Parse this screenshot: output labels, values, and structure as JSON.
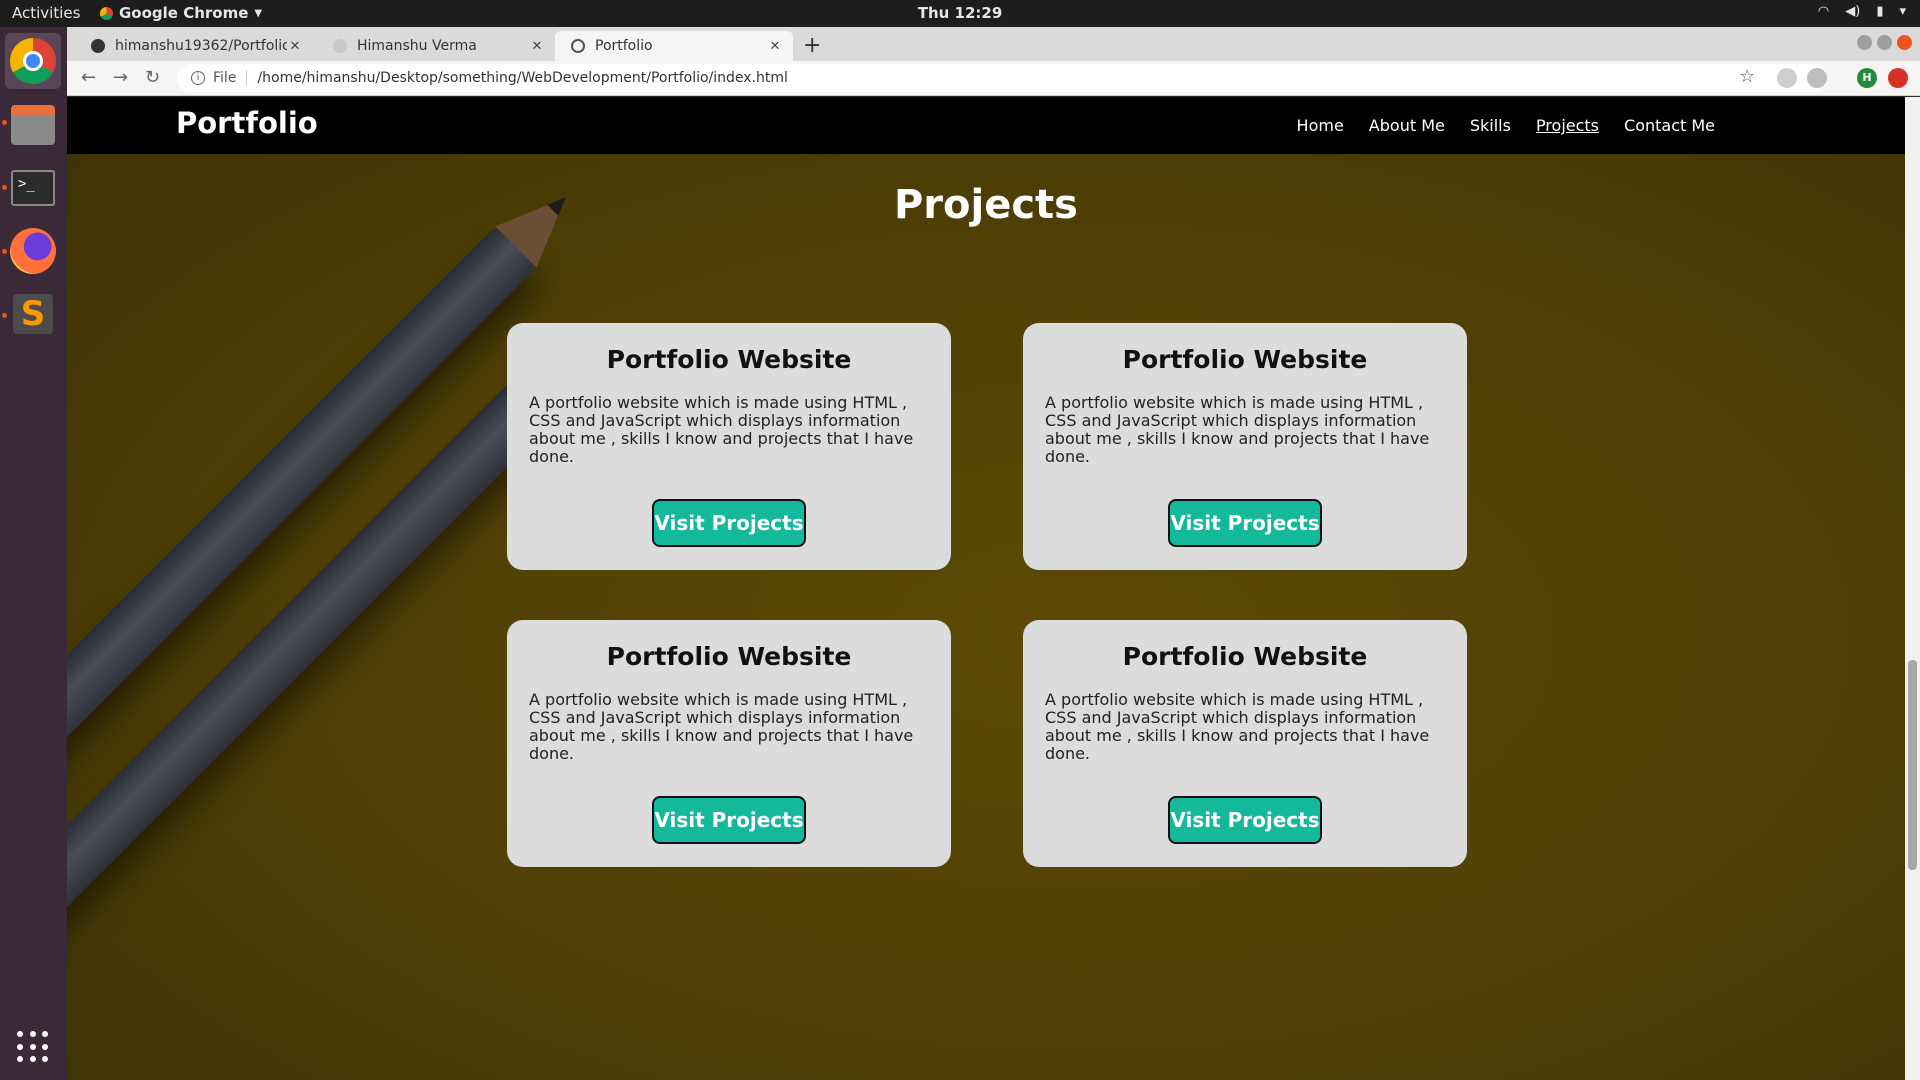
{
  "system": {
    "activities": "Activities",
    "app_name": "Google Chrome",
    "clock": "Thu 12:29"
  },
  "browser": {
    "tabs": [
      {
        "title": "himanshu19362/Portfolio",
        "active": false
      },
      {
        "title": "Himanshu Verma",
        "active": false
      },
      {
        "title": "Portfolio",
        "active": true
      }
    ],
    "scheme_label": "File",
    "url": "/home/himanshu/Desktop/something/WebDevelopment/Portfolio/index.html",
    "profile_initial": "H"
  },
  "page": {
    "brand": "Portfolio",
    "nav": [
      "Home",
      "About Me",
      "Skills",
      "Projects",
      "Contact Me"
    ],
    "current_nav": "Projects",
    "section_title": "Projects",
    "projects": [
      {
        "title": "Portfolio Website",
        "description": "A portfolio website which is made using HTML , CSS and JavaScript which displays information about me , skills I know and projects that I have done.",
        "button": "Visit Projects"
      },
      {
        "title": "Portfolio Website",
        "description": "A portfolio website which is made using HTML , CSS and JavaScript which displays information about me , skills I know and projects that I have done.",
        "button": "Visit Projects"
      },
      {
        "title": "Portfolio Website",
        "description": "A portfolio website which is made using HTML , CSS and JavaScript which displays information about me , skills I know and projects that I have done.",
        "button": "Visit Projects"
      },
      {
        "title": "Portfolio Website",
        "description": "A portfolio website which is made using HTML , CSS and JavaScript which displays information about me , skills I know and projects that I have done.",
        "button": "Visit Projects"
      }
    ],
    "colors": {
      "navbar": "#000000",
      "background": "#4f3f06",
      "card": "#dcdcdc",
      "button": "#14b89b"
    }
  }
}
